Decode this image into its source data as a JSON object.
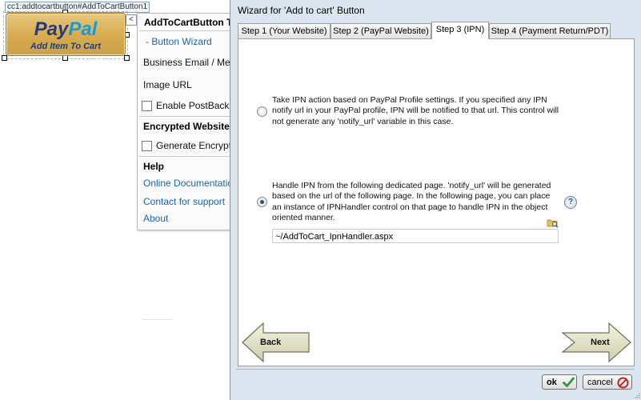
{
  "designer": {
    "control_tag": "cc1:addtocartbutton#AddToCartButton1",
    "paypal_logo_pay": "Pay",
    "paypal_logo_pal": "Pal",
    "paypal_subtitle": "Add Item To Cart"
  },
  "smart_panel": {
    "collapse_glyph": "<",
    "title": "AddToCartButton T",
    "button_wizard_link": "- Button Wizard",
    "business_email": "Business Email / Mer",
    "image_url": "Image URL",
    "enable_postback": "Enable PostBack",
    "encrypted_header": "Encrypted Website",
    "generate_encrypted": "Generate Encrypte",
    "help_header": "Help",
    "online_doc_link": "Online Documentatio",
    "contact_link": "Contact for support",
    "about_link": "About"
  },
  "wizard": {
    "title": "Wizard for 'Add to cart' Button",
    "tabs": [
      {
        "label": "Step 1 (Your Website)",
        "active": false
      },
      {
        "label": "Step 2 (PayPal Website)",
        "active": false
      },
      {
        "label": "Step 3 (IPN)",
        "active": true
      },
      {
        "label": "Step 4 (Payment Return/PDT)",
        "active": false
      }
    ],
    "option1": {
      "text": "Take IPN action based on PayPal Profile settings. If you specified any IPN notify url in your PayPal profile, IPN will be notified to that url. This control will not generate any 'notify_url' variable in this case.",
      "selected": false
    },
    "option2": {
      "text": "Handle IPN from the following dedicated page. 'notify_url' will be generated based on the url of the following page. In the following page, you can place an instance of IPNHandler control on that page to handle IPN in the object oriented manner.",
      "selected": true
    },
    "help_glyph": "?",
    "ipn_page_value": "~/AddToCart_IpnHandler.aspx",
    "back_label": "Back",
    "next_label": "Next",
    "ok_label": "ok",
    "cancel_label": "cancel",
    "colors": {
      "window_bg": "#dbe6f1",
      "link": "#1565b6",
      "ok_check": "#2e9a2e",
      "cancel_icon": "#d22020"
    }
  }
}
